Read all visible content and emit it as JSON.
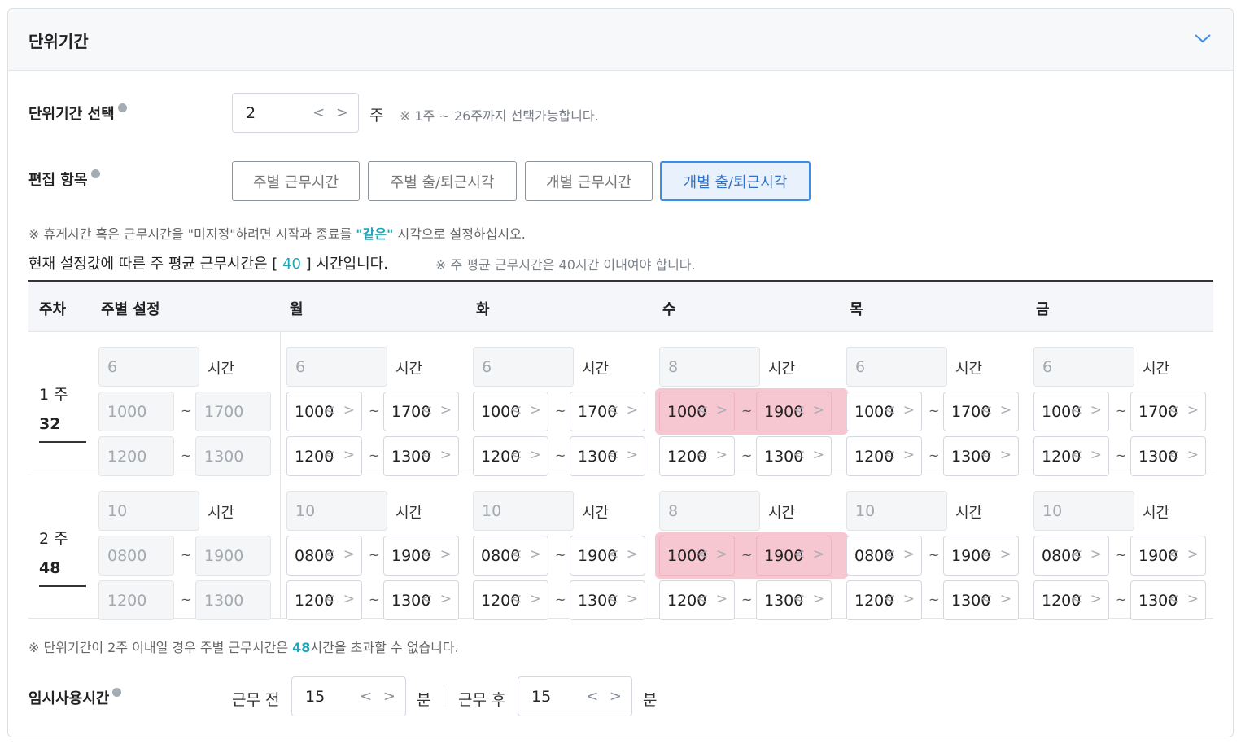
{
  "panel": {
    "title": "단위기간",
    "collapse_icon": "chevron-down-icon"
  },
  "unit_period": {
    "label": "단위기간 선택",
    "value": "2",
    "unit": "주",
    "hint": "※ 1주 ~ 26주까지 선택가능합니다."
  },
  "edit_items": {
    "label": "편집 항목",
    "buttons": [
      {
        "label": "주별 근무시간",
        "active": false
      },
      {
        "label": "주별 출/퇴근시각",
        "active": false
      },
      {
        "label": "개별 근무시간",
        "active": false
      },
      {
        "label": "개별 출/퇴근시각",
        "active": true
      }
    ]
  },
  "notes": {
    "rest_note_pre": "※ 휴게시간 혹은 근무시간을 \"미지정\"하려면 시작과 종료를 ",
    "rest_note_hl": "\"같은\"",
    "rest_note_post": " 시각으로 설정하십시오.",
    "summary_pre": "현재 설정값에 따른 주 평균 근무시간은 [ ",
    "summary_value": "40",
    "summary_post": " ] 시간입니다.",
    "summary_hint": "※ 주 평균 근무시간은 40시간 이내여야 합니다."
  },
  "table": {
    "headers": [
      "주차",
      "주별 설정",
      "월",
      "화",
      "수",
      "목",
      "금"
    ],
    "hour_unit": "시간",
    "tilde": "~",
    "weeks": [
      {
        "week_label": "1 주",
        "total_hours": "32",
        "weekly": {
          "hours": "6",
          "work_start": "1000",
          "work_end": "1700",
          "break_start": "1200",
          "break_end": "1300"
        },
        "days": [
          {
            "hours": "6",
            "work_start": "1000",
            "work_end": "1700",
            "break_start": "1200",
            "break_end": "1300",
            "highlight": false
          },
          {
            "hours": "6",
            "work_start": "1000",
            "work_end": "1700",
            "break_start": "1200",
            "break_end": "1300",
            "highlight": false
          },
          {
            "hours": "8",
            "work_start": "1000",
            "work_end": "1900",
            "break_start": "1200",
            "break_end": "1300",
            "highlight": true
          },
          {
            "hours": "6",
            "work_start": "1000",
            "work_end": "1700",
            "break_start": "1200",
            "break_end": "1300",
            "highlight": false
          },
          {
            "hours": "6",
            "work_start": "1000",
            "work_end": "1700",
            "break_start": "1200",
            "break_end": "1300",
            "highlight": false
          }
        ]
      },
      {
        "week_label": "2 주",
        "total_hours": "48",
        "weekly": {
          "hours": "10",
          "work_start": "0800",
          "work_end": "1900",
          "break_start": "1200",
          "break_end": "1300"
        },
        "days": [
          {
            "hours": "10",
            "work_start": "0800",
            "work_end": "1900",
            "break_start": "1200",
            "break_end": "1300",
            "highlight": false
          },
          {
            "hours": "10",
            "work_start": "0800",
            "work_end": "1900",
            "break_start": "1200",
            "break_end": "1300",
            "highlight": false
          },
          {
            "hours": "8",
            "work_start": "1000",
            "work_end": "1900",
            "break_start": "1200",
            "break_end": "1300",
            "highlight": true
          },
          {
            "hours": "10",
            "work_start": "0800",
            "work_end": "1900",
            "break_start": "1200",
            "break_end": "1300",
            "highlight": false
          },
          {
            "hours": "10",
            "work_start": "0800",
            "work_end": "1900",
            "break_start": "1200",
            "break_end": "1300",
            "highlight": false
          }
        ]
      }
    ]
  },
  "footer_note": {
    "pre": "※ 단위기간이 2주 이내일 경우 주별 근무시간은 ",
    "hl": "48",
    "post": "시간을 초과할 수 없습니다."
  },
  "temp_time": {
    "label": "임시사용시간",
    "before_label": "근무 전",
    "before_value": "15",
    "after_label": "근무 후",
    "after_value": "15",
    "unit": "분"
  },
  "colors": {
    "accent": "#3b8ee8",
    "highlight": "#f7c7d1",
    "teal": "#1aa7b7"
  }
}
